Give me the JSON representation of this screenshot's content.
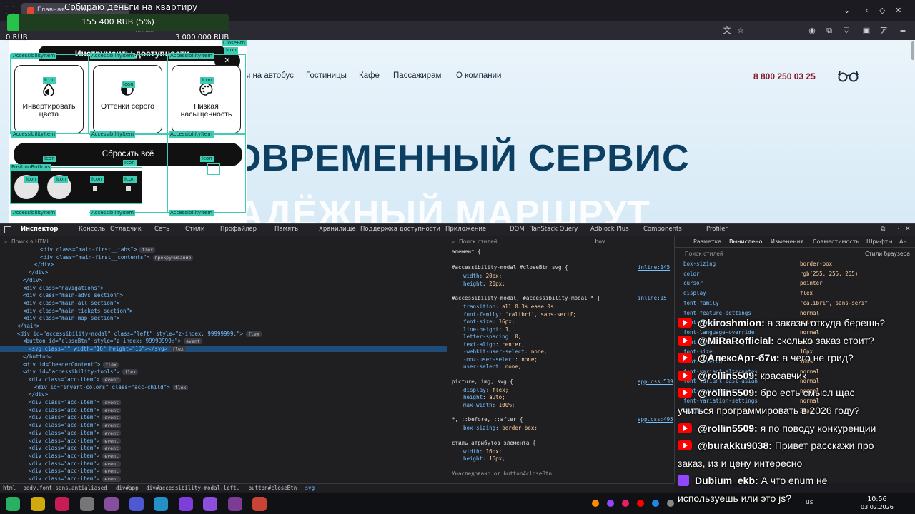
{
  "browser": {
    "tab_title": "Главная - Laravel",
    "url_partial": "тинная"
  },
  "donation": {
    "title": "Собираю деньги на квартиру",
    "amount": "155 400 RUB (5%)",
    "progress": 0.052,
    "min": "0 RUB",
    "max": "3 000 000 RUB"
  },
  "site": {
    "nav": [
      "ы на автобус",
      "Гостиницы",
      "Кафе",
      "Пассажирам",
      "О компании"
    ],
    "phone": "8 800 250 03 25",
    "hero_line1": "ОВРЕМЕННЫЙ СЕРВИС",
    "hero_line2": "НАДЁЖНЫЙ МАРШРУТ"
  },
  "modal": {
    "title": "Инструменты доступности",
    "cards": [
      "Инвертировать цвета",
      "Оттенки серого",
      "Низкая насыщенность"
    ],
    "reset": "Сбросить всё",
    "dbg": {
      "item": "AccessibilityItem",
      "icon": "Icon",
      "close": "CloseBtn",
      "pos": "PositionButtons"
    }
  },
  "devtools": {
    "tabs": [
      "Инспектор",
      "Консоль",
      "Отладчик",
      "Сеть",
      "Стили",
      "Профайлер",
      "Память",
      "Хранилище",
      "Поддержка доступности",
      "Приложение",
      "DOM",
      "TanStack Query",
      "Adblock Plus",
      "Components",
      "Profiler"
    ],
    "search_html": "Поиск в HTML",
    "search_styles": "Поиск стилей",
    "computed_tabs": [
      "Разметка",
      "Вычислено",
      "Изменения",
      "Совместимость",
      "Шрифты",
      "Ан"
    ],
    "browser_styles": "Стили браузера",
    "hov": ":hov",
    ".cls": ".cls",
    "html_lines": [
      {
        "i": 6,
        "t": "<div class=\"main-first__tabs\">",
        "b": "flex"
      },
      {
        "i": 6,
        "t": "<div class=\"main-first__contents\">",
        "b": "прокручивание"
      },
      {
        "i": 5,
        "t": "</div>",
        "b": ""
      },
      {
        "i": 4,
        "t": "</div>",
        "b": ""
      },
      {
        "i": 3,
        "t": "</div>",
        "b": ""
      },
      {
        "i": 3,
        "t": "<div class=\"navigations\">",
        "b": ""
      },
      {
        "i": 3,
        "t": "<div class=\"main-advs section\">",
        "b": ""
      },
      {
        "i": 3,
        "t": "<div class=\"main-all section\">",
        "b": ""
      },
      {
        "i": 3,
        "t": "<div class=\"main-tickets section\">",
        "b": ""
      },
      {
        "i": 3,
        "t": "<div class=\"main-map section\">",
        "b": ""
      },
      {
        "i": 2,
        "t": "</main>",
        "b": ""
      },
      {
        "i": 2,
        "t": "<div id=\"accessibility-modal\" class=\"left\" style=\"z-index: 99999999;\">",
        "b": "flex"
      },
      {
        "i": 3,
        "t": "<button id=\"closeBtn\" style=\"z-index: 99999999;\">",
        "b": "event"
      },
      {
        "i": 4,
        "t": "<svg class=\"\" width=\"16\" height=\"16\"></svg>",
        "b": "flex"
      },
      {
        "i": 3,
        "t": "</button>",
        "b": ""
      },
      {
        "i": 3,
        "t": "<div id=\"headerContent\">",
        "b": "flex"
      },
      {
        "i": 3,
        "t": "<div id=\"accessibility-tools\">",
        "b": "flex"
      },
      {
        "i": 4,
        "t": "<div class=\"acc-item\">",
        "b": "event"
      },
      {
        "i": 5,
        "t": "<div id=\"invert-colors\" class=\"acc-child\">",
        "b": "flex"
      },
      {
        "i": 4,
        "t": "</div>",
        "b": ""
      },
      {
        "i": 4,
        "t": "<div class=\"acc-item\">",
        "b": "event"
      },
      {
        "i": 4,
        "t": "<div class=\"acc-item\">",
        "b": "event"
      },
      {
        "i": 4,
        "t": "<div class=\"acc-item\">",
        "b": "event"
      },
      {
        "i": 4,
        "t": "<div class=\"acc-item\">",
        "b": "event"
      },
      {
        "i": 4,
        "t": "<div class=\"acc-item\">",
        "b": "event"
      },
      {
        "i": 4,
        "t": "<div class=\"acc-item\">",
        "b": "event"
      },
      {
        "i": 4,
        "t": "<div class=\"acc-item\">",
        "b": "event"
      },
      {
        "i": 4,
        "t": "<div class=\"acc-item\">",
        "b": "event"
      },
      {
        "i": 4,
        "t": "<div class=\"acc-item\">",
        "b": "event"
      },
      {
        "i": 4,
        "t": "<div class=\"acc-item\">",
        "b": "event"
      },
      {
        "i": 4,
        "t": "<div class=\"acc-item\">",
        "b": "event"
      }
    ],
    "rules": [
      {
        "sel": "элемент {",
        "src": "",
        "props": []
      },
      {
        "sel": "#accessibility-modal #closeBtn svg {",
        "src": "inline:145",
        "props": [
          [
            "width",
            "20px;"
          ],
          [
            "height",
            "20px;"
          ]
        ]
      },
      {
        "sel": "#accessibility-modal, #accessibility-modal * {",
        "src": "inline:15",
        "props": [
          [
            "transition",
            "all 0.3s ease 0s;"
          ],
          [
            "font-family",
            "'calibri', sans-serif;"
          ],
          [
            "font-size",
            "16px;"
          ],
          [
            "line-height",
            "1;"
          ],
          [
            "letter-spacing",
            "0;"
          ],
          [
            "text-align",
            "center;"
          ],
          [
            "-webkit-user-select",
            "none;"
          ],
          [
            "-moz-user-select",
            "none;"
          ],
          [
            "user-select",
            "none;"
          ]
        ]
      },
      {
        "sel": "picture, img, svg {",
        "src": "app.css:539",
        "props": [
          [
            "display",
            "flex;"
          ],
          [
            "height",
            "auto;"
          ],
          [
            "max-width",
            "100%;"
          ]
        ]
      },
      {
        "sel": "*, ::before, ::after {",
        "src": "app.css:495",
        "props": [
          [
            "box-sizing",
            "border-box;"
          ]
        ]
      },
      {
        "sel": "стиль атрибутов элемента {",
        "src": "",
        "props": [
          [
            "width",
            "16px;"
          ],
          [
            "height",
            "16px;"
          ]
        ]
      }
    ],
    "inherited": "Унаследовано от button#closeBtn",
    "computed": [
      [
        "box-sizing",
        "border-box"
      ],
      [
        "color",
        "rgb(255, 255, 255)"
      ],
      [
        "cursor",
        "pointer"
      ],
      [
        "display",
        "flex"
      ],
      [
        "font-family",
        "\"calibri\", sans-serif"
      ],
      [
        "font-feature-settings",
        "normal"
      ],
      [
        "font-kerning",
        "auto"
      ],
      [
        "font-language-override",
        "normal"
      ],
      [
        "font-optical-sizing",
        "auto"
      ],
      [
        "font-size",
        "16px"
      ],
      [
        "font-stretch",
        "100%"
      ],
      [
        "font-variant-alternates",
        "normal"
      ],
      [
        "font-variant-east-asian",
        "normal"
      ],
      [
        "font-variant-numeric",
        "normal"
      ],
      [
        "font-variation-settings",
        "normal"
      ],
      [
        "height",
        "20px"
      ]
    ],
    "breadcrumbs": [
      "html",
      "body.font-sans.antialiased",
      "div#app",
      "div#accessibility-modal.left.",
      "button#closeBtn",
      "svg"
    ]
  },
  "chat": [
    {
      "src": "yt",
      "user": "@kiroshmion:",
      "msg": "а заказы откуда берешь?"
    },
    {
      "src": "yt",
      "user": "@MiRaRofficial:",
      "msg": "сколько заказ стоит?"
    },
    {
      "src": "yt",
      "user": "@АлексАрт-б7и:",
      "msg": "а чего не грид?"
    },
    {
      "src": "yt",
      "user": "@rollin5509:",
      "msg": "красавчик"
    },
    {
      "src": "yt",
      "user": "@rollin5509:",
      "msg": "бро есть смысл щас"
    },
    {
      "src": "",
      "user": "",
      "msg": "учиться программировать в 2026 году?"
    },
    {
      "src": "yt",
      "user": "@rollin5509:",
      "msg": "я по поводу конкуренции"
    },
    {
      "src": "yt",
      "user": "@burakku9038:",
      "msg": "Привет расскажи про"
    },
    {
      "src": "",
      "user": "",
      "msg": "заказ, из и цену интересно"
    },
    {
      "src": "tw",
      "user": "Dubium_ekb:",
      "msg": "А что enum не"
    },
    {
      "src": "",
      "user": "",
      "msg": "используешь или это js?"
    }
  ],
  "taskbar": {
    "lang": "us",
    "time": "10:56",
    "date": "03.02.2026"
  },
  "colors": {
    "accent": "#3ecdb3",
    "phone": "#8a1c2b",
    "progress": "#27c24a"
  }
}
